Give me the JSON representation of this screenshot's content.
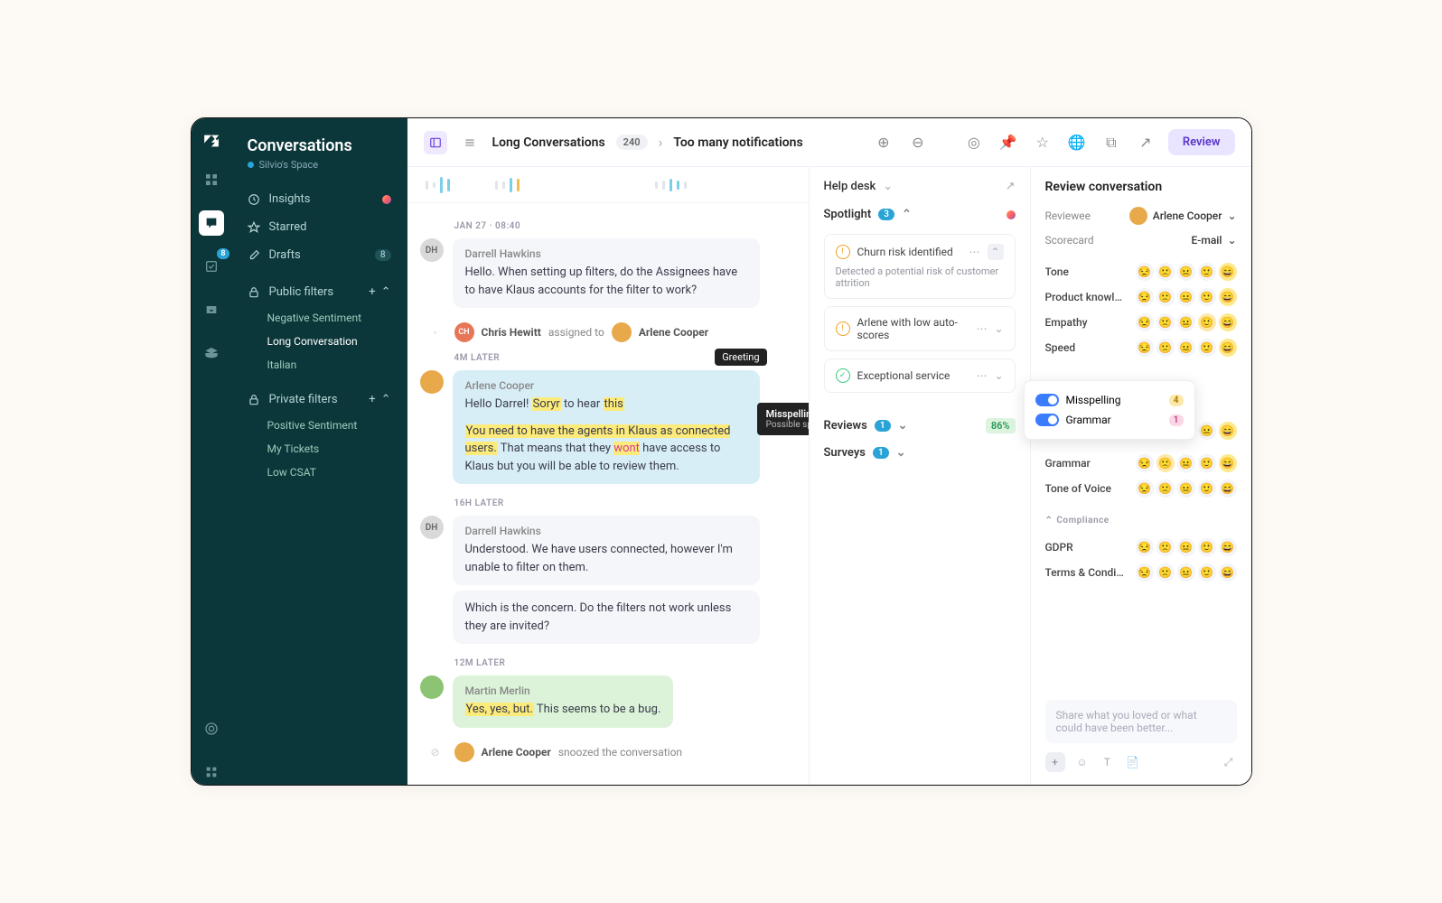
{
  "sidebar": {
    "title": "Conversations",
    "space": "Silvio's Space",
    "rail_badge": "8",
    "nav": [
      {
        "icon": "clock",
        "label": "Insights",
        "indicator": "dot"
      },
      {
        "icon": "star",
        "label": "Starred"
      },
      {
        "icon": "pencil",
        "label": "Drafts",
        "badge": "8"
      }
    ],
    "public_label": "Public filters",
    "public": [
      {
        "label": "Negative Sentiment"
      },
      {
        "label": "Long Conversation",
        "active": true
      },
      {
        "label": "Italian"
      }
    ],
    "private_label": "Private filters",
    "private": [
      {
        "label": "Positive Sentiment"
      },
      {
        "label": "My Tickets"
      },
      {
        "label": "Low CSAT"
      }
    ]
  },
  "topbar": {
    "crumb1": "Long Conversations",
    "count": "240",
    "crumb2": "Too many notifications",
    "review_btn": "Review"
  },
  "convo": {
    "date": "Jan 27 · 08:40",
    "msg1_author": "Darrell Hawkins",
    "msg1_text": "Hello. When setting up filters, do the Assignees have to have Klaus accounts for the filter to work?",
    "assign_who": "Chris Hewitt",
    "assign_verb": "assigned to",
    "assign_to": "Arlene Cooper",
    "gap1": "4m later",
    "msg2_author": "Arlene Cooper",
    "msg2_a": "Hello Darrel! ",
    "msg2_b": "Soryr",
    "msg2_c": " to hear ",
    "msg2_d": "this",
    "msg2_e": "You need to have the agents in Klaus as connected users.",
    "msg2_f": " That means that they ",
    "msg2_g": "wont",
    "msg2_h": " have access to Klaus but you will be able to review them.",
    "greeting": "Greeting",
    "tooltip_title": "Misspelling",
    "tooltip_sub": "Possible spelling mistake",
    "gap2": "16h later",
    "msg3_author": "Darrell Hawkins",
    "msg3_text": "Understood. We have users connected, however I'm unable to filter on them.",
    "msg4_text": "Which is the concern. Do the filters not work unless they are invited?",
    "gap3": "12m later",
    "msg5_author": "Martin Merlin",
    "msg5_a": "Yes, yes, but.",
    "msg5_b": " This seems to be a bug.",
    "snooze_who": "Arlene Cooper",
    "snooze_verb": "snoozed the conversation"
  },
  "mid": {
    "helpdesk": "Help desk",
    "spotlight": "Spotlight",
    "spotlight_count": "3",
    "cards": [
      {
        "icon": "warn",
        "title": "Churn risk identified",
        "desc": "Detected a potential risk of customer attrition",
        "open": true
      },
      {
        "icon": "warn",
        "title": "Arlene with low auto-scores"
      },
      {
        "icon": "good",
        "title": "Exceptional service"
      }
    ],
    "reviews": "Reviews",
    "reviews_count": "1",
    "reviews_pct": "86%",
    "surveys": "Surveys",
    "surveys_count": "1"
  },
  "review": {
    "title": "Review conversation",
    "reviewee_lbl": "Reviewee",
    "reviewee": "Arlene Cooper",
    "scorecard_lbl": "Scorecard",
    "scorecard": "E-mail",
    "scores": [
      {
        "label": "Tone",
        "sel": 5
      },
      {
        "label": "Product knowle...",
        "sel": 5
      },
      {
        "label": "Empathy",
        "sel": 5,
        "four": true
      },
      {
        "label": "Speed",
        "sel": 5
      }
    ],
    "scores2": [
      {
        "label": "Grammar",
        "sel": 5,
        "two": true
      },
      {
        "label": "Tone of Voice"
      }
    ],
    "hidden_label": "...",
    "compliance_lbl": "Compliance",
    "compliance": [
      {
        "label": "GDPR"
      },
      {
        "label": "Terms & Conditi..."
      }
    ],
    "popup": {
      "row1": "Misspelling",
      "badge1": "4",
      "row2": "Grammar",
      "badge2": "1"
    },
    "comment_placeholder": "Share what you loved or what could have been better..."
  }
}
